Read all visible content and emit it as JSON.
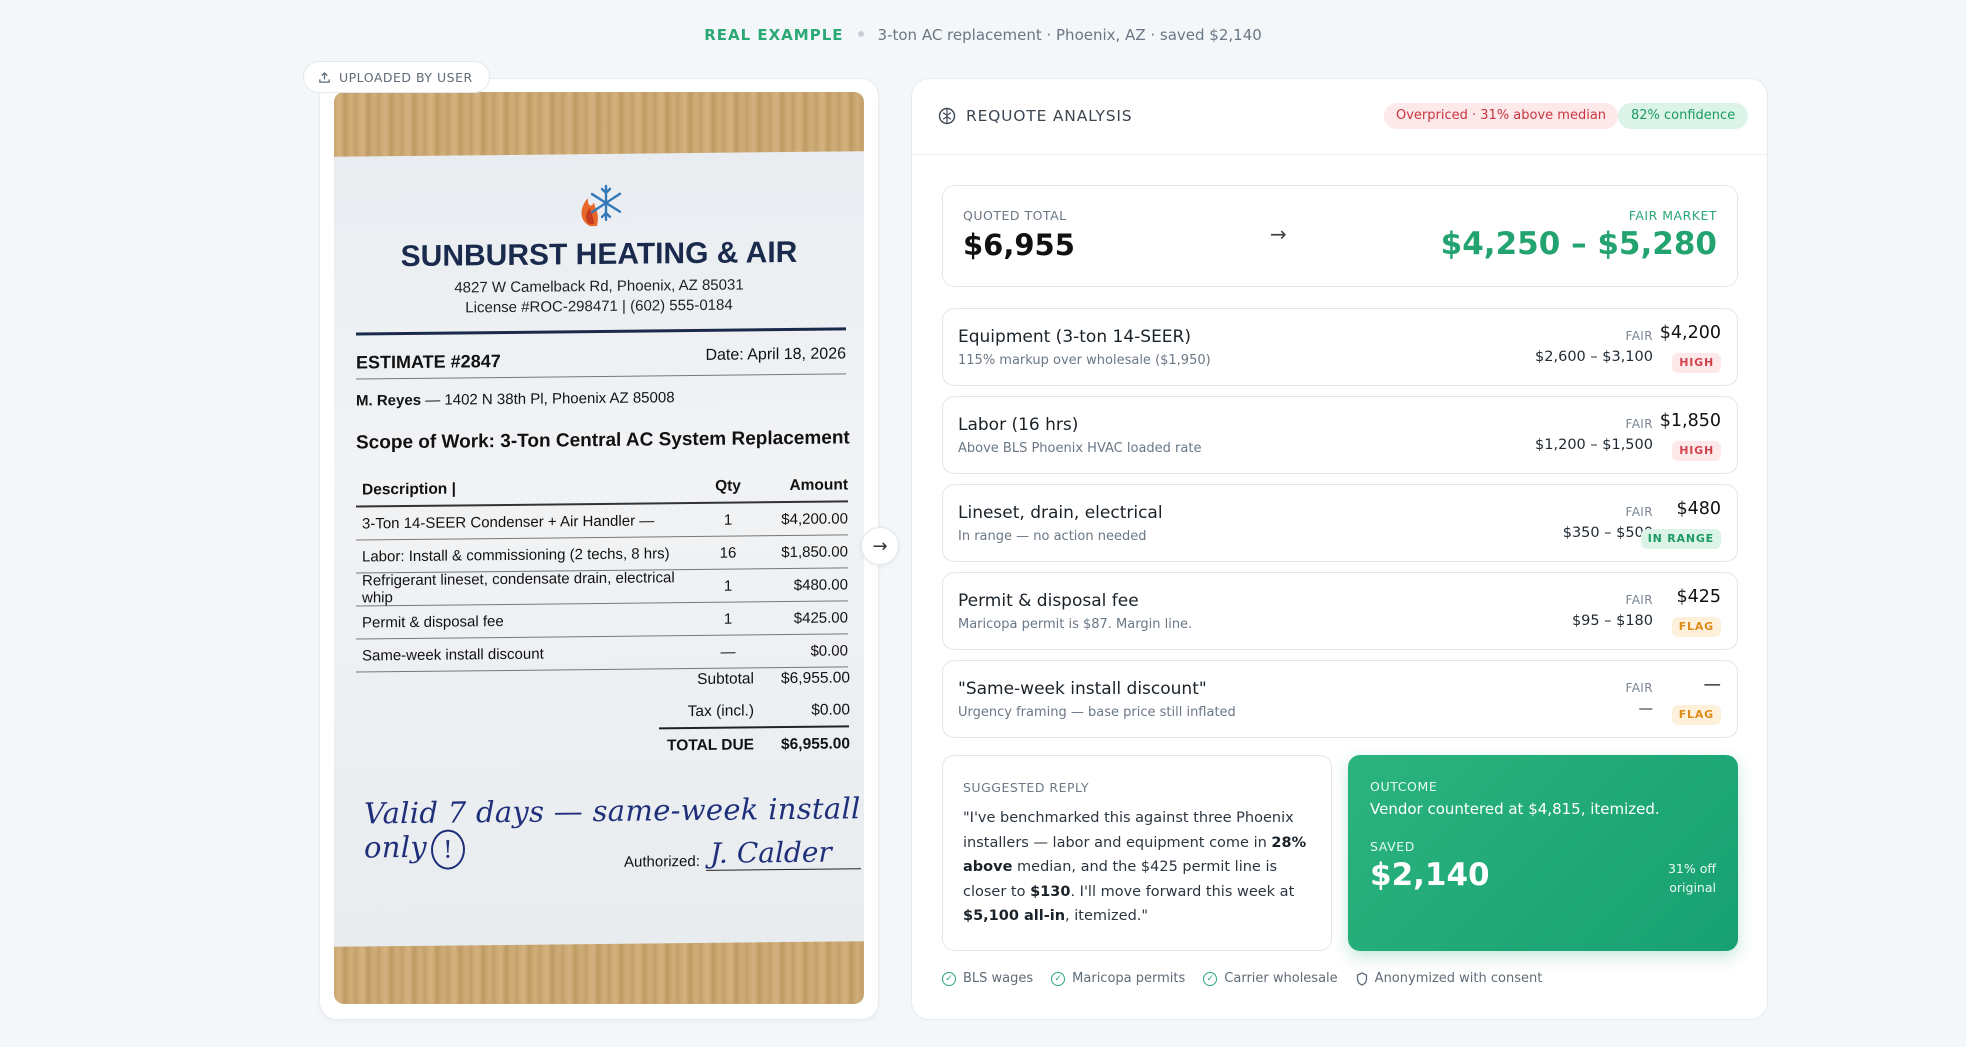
{
  "header": {
    "tag": "REAL EXAMPLE",
    "summary": "3-ton AC replacement · Phoenix, AZ · saved $2,140"
  },
  "upload": {
    "pill_label": "UPLOADED BY USER",
    "pill_icon": "upload-icon"
  },
  "estimate": {
    "company": "SUNBURST HEATING & AIR",
    "address": "4827 W Camelback Rd, Phoenix, AZ 85031",
    "license": "License #ROC-298471 | (602) 555-0184",
    "estimate_no": "ESTIMATE #2847",
    "date": "Date: April 18, 2026",
    "customer_name": "M. Reyes",
    "customer_addr": " — 1402 N 38th Pl, Phoenix AZ 85008",
    "scope": "Scope of Work: 3-Ton Central AC System Replacement",
    "columns": {
      "desc": "Description |",
      "qty": "Qty",
      "amount": "Amount"
    },
    "rows": [
      {
        "desc": "3-Ton 14-SEER Condenser + Air Handler —",
        "qty": "1",
        "amount": "$4,200.00"
      },
      {
        "desc": "Labor: Install & commissioning (2 techs, 8 hrs)",
        "qty": "16",
        "amount": "$1,850.00"
      },
      {
        "desc": "Refrigerant lineset, condensate drain, electrical whip",
        "qty": "1",
        "amount": "$480.00"
      },
      {
        "desc": "Permit & disposal fee",
        "qty": "1",
        "amount": "$425.00"
      },
      {
        "desc": "Same-week install discount",
        "qty": "—",
        "amount": "$0.00"
      }
    ],
    "subtotal_label": "Subtotal",
    "subtotal": "$6,955.00",
    "tax_label": "Tax (incl.)",
    "tax": "$0.00",
    "total_label": "TOTAL DUE",
    "total": "$6,955.00",
    "handwritten_note": "Valid 7 days — same-week install only",
    "handwritten_mark": "!",
    "authorized_label": "Authorized:",
    "signature": "J. Calder"
  },
  "analysis": {
    "title": "REQUOTE ANALYSIS",
    "title_icon": "brain-icon",
    "overpriced_badge": "Overpriced · 31% above median",
    "confidence_badge": "82% confidence",
    "quoted_label": "QUOTED TOTAL",
    "quoted_value": "$6,955",
    "fair_label": "FAIR MARKET",
    "fair_value": "$4,250 – $5,280",
    "items": [
      {
        "name": "Equipment (3-ton 14-SEER)",
        "note": "115% markup over wholesale ($1,950)",
        "fair_label": "FAIR",
        "range": "$2,600 – $3,100",
        "price": "$4,200",
        "tag": "HIGH",
        "tag_type": "high"
      },
      {
        "name": "Labor (16 hrs)",
        "note": "Above BLS Phoenix HVAC loaded rate",
        "fair_label": "FAIR",
        "range": "$1,200 – $1,500",
        "price": "$1,850",
        "tag": "HIGH",
        "tag_type": "high"
      },
      {
        "name": "Lineset, drain, electrical",
        "note": "In range — no action needed",
        "fair_label": "FAIR",
        "range": "$350 – $500",
        "price": "$480",
        "tag": "IN RANGE",
        "tag_type": "range"
      },
      {
        "name": "Permit & disposal fee",
        "note": "Maricopa permit is $87. Margin line.",
        "fair_label": "FAIR",
        "range": "$95 – $180",
        "price": "$425",
        "tag": "FLAG",
        "tag_type": "flag"
      },
      {
        "name": "\"Same-week install discount\"",
        "note": "Urgency framing — base price still inflated",
        "fair_label": "FAIR",
        "range": "—",
        "price": "—",
        "tag": "FLAG",
        "tag_type": "flag"
      }
    ],
    "reply": {
      "label": "SUGGESTED REPLY",
      "p1": "\"I've benchmarked this against three Phoenix installers — labor and equipment come in ",
      "b1": "28% above",
      "p2": " median, and the $425 permit line is closer to ",
      "b2": "$130",
      "p3": ". I'll move forward this week at ",
      "b3": "$5,100 all-in",
      "p4": ", itemized.\""
    },
    "outcome": {
      "label": "OUTCOME",
      "text": "Vendor countered at $4,815, itemized.",
      "saved_label": "SAVED",
      "saved": "$2,140",
      "pct_line1": "31% off",
      "pct_line2": "original"
    },
    "sources": [
      {
        "label": "BLS wages",
        "icon": "check-circle-icon"
      },
      {
        "label": "Maricopa permits",
        "icon": "check-circle-icon"
      },
      {
        "label": "Carrier wholesale",
        "icon": "check-circle-icon"
      },
      {
        "label": "Anonymized with consent",
        "icon": "shield-icon"
      }
    ]
  },
  "colors": {
    "accent_green": "#23a36f",
    "red": "#c8363f",
    "flag_orange": "#e08a1c",
    "navy": "#1a2a4d"
  }
}
